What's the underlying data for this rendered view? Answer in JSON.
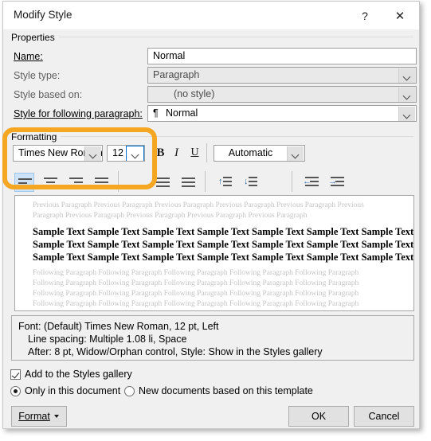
{
  "window": {
    "title": "Modify Style",
    "help_label": "?",
    "close_label": "✕"
  },
  "properties": {
    "group_label": "Properties",
    "name_label": "Name:",
    "name_value": "Normal",
    "style_type_label": "Style type:",
    "style_type_value": "Paragraph",
    "style_based_on_label": "Style based on:",
    "style_based_on_value": "(no style)",
    "following_label": "Style for following paragraph:",
    "following_value": "Normal",
    "pilcrow": "¶"
  },
  "formatting": {
    "group_label": "Formatting",
    "font_name": "Times New Roman",
    "font_size": "12",
    "bold_label": "B",
    "italic_label": "I",
    "underline_label": "U",
    "font_color": "Automatic",
    "align_left": "align-left",
    "align_center": "align-center",
    "align_right": "align-right",
    "align_justify": "align-justify",
    "line_spacing_decrease": "line-spacing-decrease",
    "line_spacing_increase": "line-spacing-increase",
    "indent_decrease": "decrease-indent",
    "indent_increase": "increase-indent",
    "spacing_up_glyph": "↑",
    "spacing_down_glyph": "↓",
    "indent_left_glyph": "←",
    "indent_right_glyph": "→"
  },
  "preview": {
    "previous_paragraph_lines": [
      "Previous Paragraph Previous Paragraph Previous Paragraph Previous Paragraph Previous Paragraph Previous",
      "Paragraph Previous Paragraph Previous Paragraph Previous Paragraph Previous Paragraph"
    ],
    "sample_lines": [
      "Sample Text Sample Text Sample Text Sample Text Sample Text Sample Text Sample Text",
      "Sample Text Sample Text Sample Text Sample Text Sample Text Sample Text Sample Text",
      "Sample Text Sample Text Sample Text Sample Text Sample Text Sample Text Sample Text"
    ],
    "following_paragraph_lines": [
      "Following Paragraph Following Paragraph Following Paragraph Following Paragraph Following Paragraph",
      "Following Paragraph Following Paragraph Following Paragraph Following Paragraph Following Paragraph",
      "Following Paragraph Following Paragraph Following Paragraph Following Paragraph Following Paragraph",
      "Following Paragraph Following Paragraph Following Paragraph Following Paragraph Following Paragraph"
    ]
  },
  "description": {
    "line1": "Font: (Default) Times New Roman, 12 pt, Left",
    "line2": "Line spacing:  Multiple 1.08 li, Space",
    "line3": "After:  8 pt, Widow/Orphan control, Style: Show in the Styles gallery"
  },
  "options": {
    "add_to_gallery": "Add to the Styles gallery",
    "only_this_document": "Only in this document",
    "new_documents": "New documents based on this template"
  },
  "buttons": {
    "format": "Format",
    "ok": "OK",
    "cancel": "Cancel"
  },
  "colors": {
    "annotation": "#f5a623",
    "accent": "#0078d7",
    "dialog_bg": "#f0f0f0"
  }
}
